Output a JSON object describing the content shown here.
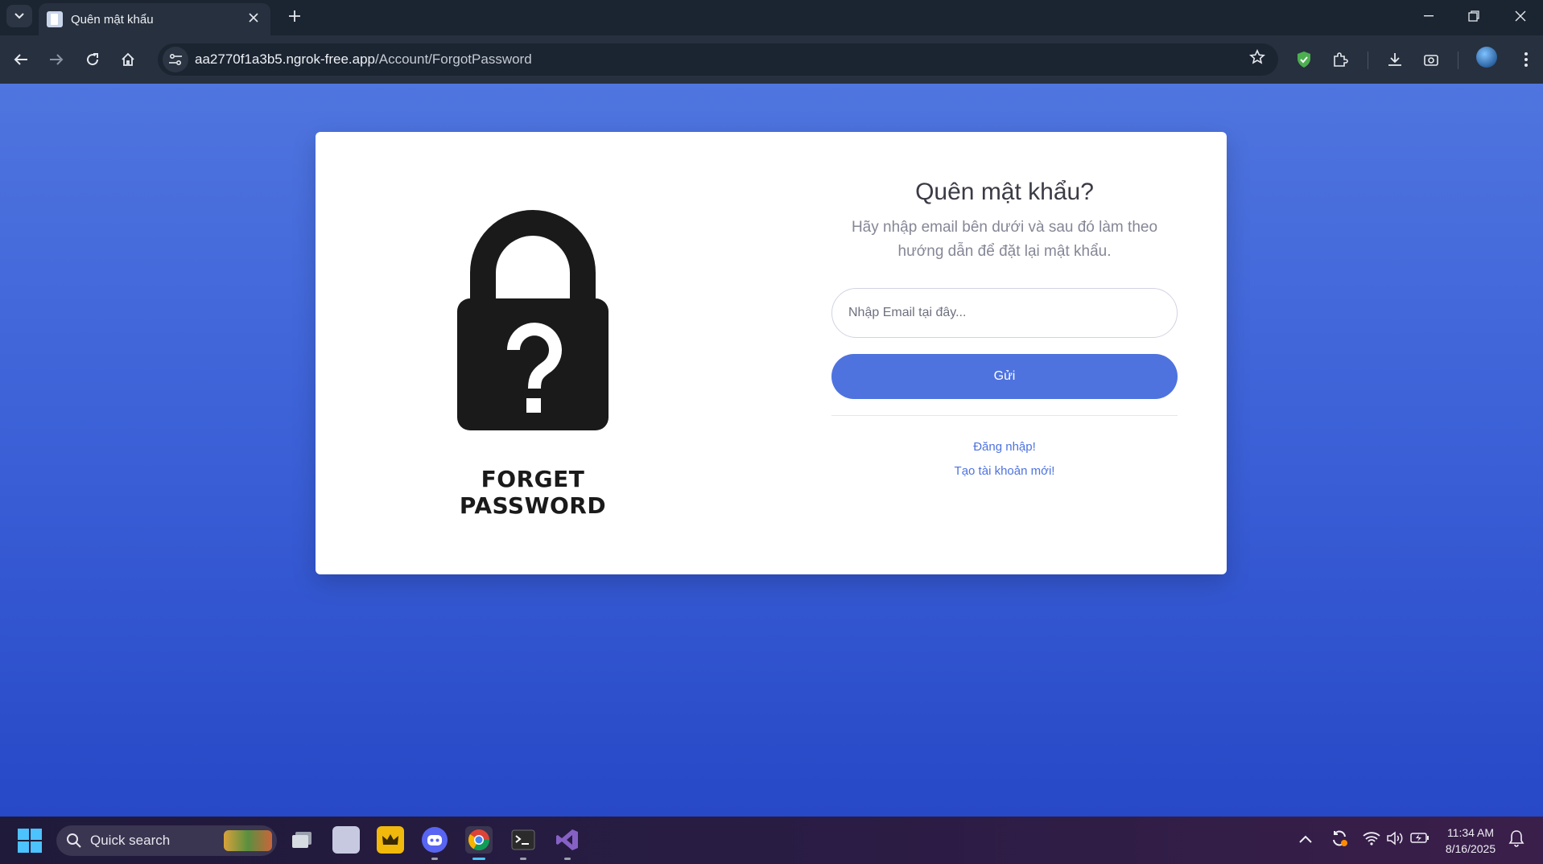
{
  "browser": {
    "tab_title": "Quên mật khẩu",
    "url_host": "aa2770f1a3b5.ngrok-free.app",
    "url_path": "/Account/ForgotPassword"
  },
  "illustration": {
    "line1": "FORGET",
    "line2": "PASSWORD"
  },
  "form": {
    "title": "Quên mật khẩu?",
    "subtitle": "Hãy nhập email bên dưới và sau đó làm theo hướng dẫn để đặt lại mật khẩu.",
    "email_placeholder": "Nhập Email tại đây...",
    "submit_label": "Gửi",
    "login_link": "Đăng nhập!",
    "register_link": "Tạo tài khoản mới!"
  },
  "taskbar": {
    "search_label": "Quick search",
    "time": "11:34 AM",
    "date": "8/16/2025"
  },
  "colors": {
    "accent": "#4e73df",
    "page_bg_top": "#4f75df",
    "page_bg_bottom": "#2748c7"
  }
}
